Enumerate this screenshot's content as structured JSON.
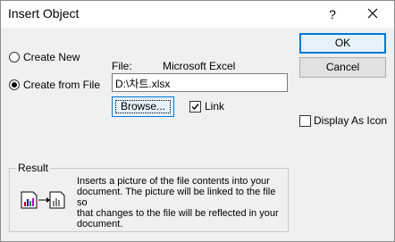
{
  "window": {
    "title": "Insert Object",
    "help_label": "?"
  },
  "options": {
    "create_new": "Create New",
    "create_from_file": "Create from File",
    "selected": "create_from_file"
  },
  "file": {
    "label": "File:",
    "app_name": "Microsoft Excel",
    "path": "D:\\차트.xlsx",
    "browse_label": "Browse...",
    "link_label": "Link",
    "link_checked": true
  },
  "buttons": {
    "ok": "OK",
    "cancel": "Cancel"
  },
  "display_as_icon": {
    "label": "Display As Icon",
    "checked": false
  },
  "result": {
    "title": "Result",
    "lines": [
      "Inserts a picture of the file contents into your",
      "document.  The picture will be linked to the file so",
      "that changes to the file will be reflected in your",
      "document."
    ],
    "icon": "linked-chart-icon"
  }
}
